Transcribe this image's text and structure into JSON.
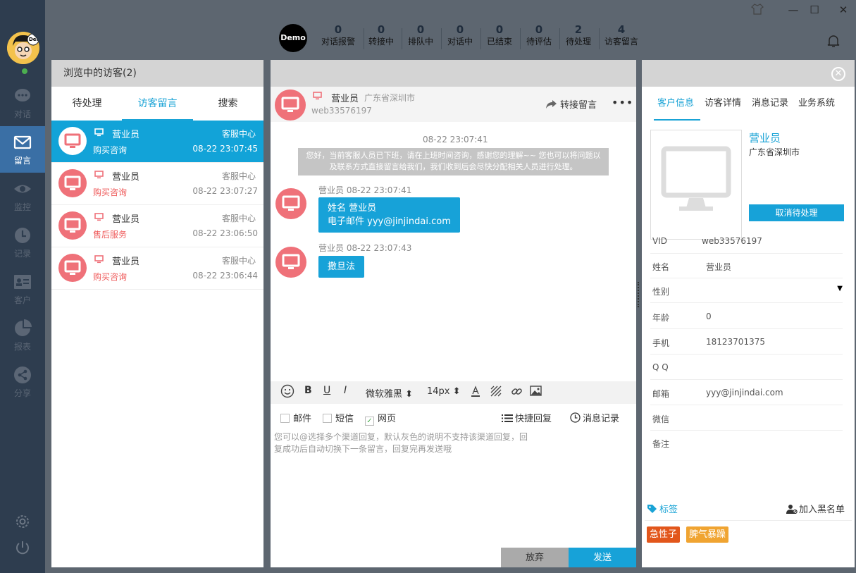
{
  "nav": {
    "items": [
      {
        "label": "对话",
        "icon": "chat-bubble-icon"
      },
      {
        "label": "留言",
        "icon": "envelope-icon"
      },
      {
        "label": "监控",
        "icon": "eye-icon"
      },
      {
        "label": "记录",
        "icon": "clock-icon"
      },
      {
        "label": "客户",
        "icon": "contact-card-icon"
      },
      {
        "label": "报表",
        "icon": "pie-chart-icon"
      },
      {
        "label": "分享",
        "icon": "share-icon"
      }
    ],
    "active_index": 1,
    "avatar_badge": "Demo"
  },
  "topbar": {
    "demo_badge": "Demo",
    "stats": [
      {
        "num": "0",
        "label": "对话报警"
      },
      {
        "num": "0",
        "label": "转接中"
      },
      {
        "num": "0",
        "label": "排队中"
      },
      {
        "num": "0",
        "label": "对话中"
      },
      {
        "num": "0",
        "label": "已结束"
      },
      {
        "num": "0",
        "label": "待评估"
      },
      {
        "num": "2",
        "label": "待处理"
      },
      {
        "num": "4",
        "label": "访客留言"
      }
    ]
  },
  "left_panel": {
    "title": "浏览中的访客(2)",
    "tabs": [
      "待处理",
      "访客留言",
      "搜索"
    ],
    "active_tab": 1,
    "visitors": [
      {
        "name": "营业员",
        "topic": "购买咨询",
        "dept": "客服中心",
        "time": "08-22 23:07:45",
        "active": true
      },
      {
        "name": "营业员",
        "topic": "购买咨询",
        "dept": "客服中心",
        "time": "08-22 23:07:27",
        "active": false
      },
      {
        "name": "营业员",
        "topic": "售后服务",
        "dept": "客服中心",
        "time": "08-22 23:06:50",
        "active": false
      },
      {
        "name": "营业员",
        "topic": "购买咨询",
        "dept": "客服中心",
        "time": "08-22 23:06:44",
        "active": false
      }
    ]
  },
  "chat": {
    "visitor_name": "营业员",
    "location": "广东省深圳市",
    "vid": "web33576197",
    "transfer_label": "转接留言",
    "more_label": "•••",
    "system_time": "08-22 23:07:41",
    "system_message": "您好，当前客服人员已下班，请在上班时间咨询，感谢您的理解~~ 您也可以将问题以及联系方式直接留言给我们，我们收到后会尽快分配相关人员进行处理。",
    "messages": [
      {
        "meta": "营业员  08-22 23:07:41",
        "lines": [
          "姓名 营业员",
          "电子邮件 yyy@jinjindai.com"
        ]
      },
      {
        "meta": "营业员  08-22 23:07:43",
        "lines": [
          "撒旦法"
        ]
      }
    ],
    "toolbar": {
      "font": "微软雅黑 ⬍",
      "size": "14px ⬍",
      "bold": "B",
      "underline": "U",
      "italic": "I"
    },
    "channels": [
      {
        "label": "邮件",
        "checked": false
      },
      {
        "label": "短信",
        "checked": false
      },
      {
        "label": "网页",
        "checked": true
      }
    ],
    "quick_reply": "快捷回复",
    "msg_history": "消息记录",
    "reply_placeholder": "您可以@选择多个渠道回复，默认灰色的说明不支持该渠道回复，回复成功后自动切换下一条留言，回复完再发送哦",
    "discard_label": "放弃",
    "send_label": "发送"
  },
  "right_panel": {
    "tabs": [
      "客户信息",
      "访客详情",
      "消息记录",
      "业务系统"
    ],
    "active_tab": 0,
    "name": "营业员",
    "location": "广东省深圳市",
    "cancel_label": "取消待处理",
    "fields": [
      {
        "key": "VID",
        "value": "web33576197"
      },
      {
        "key": "姓名",
        "value": "营业员"
      },
      {
        "key": "性别",
        "value": ""
      },
      {
        "key": "年龄",
        "value": "0"
      },
      {
        "key": "手机",
        "value": "18123701375"
      },
      {
        "key": "Q Q",
        "value": ""
      },
      {
        "key": "邮箱",
        "value": "yyy@jinjindai.com"
      },
      {
        "key": "微信",
        "value": ""
      },
      {
        "key": "备注",
        "value": ""
      }
    ],
    "tag_title": "标签",
    "blacklist_label": "加入黑名单",
    "tags": [
      {
        "label": "急性子",
        "color": "#e2561b"
      },
      {
        "label": "脾气暴躁",
        "color": "#f0a431"
      }
    ]
  }
}
